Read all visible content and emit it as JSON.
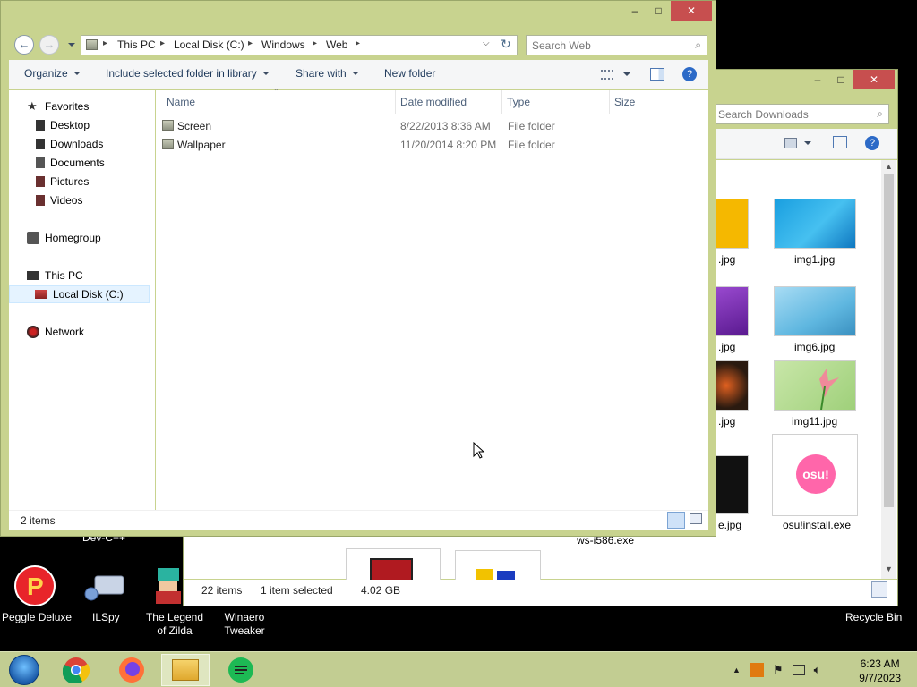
{
  "desktop": {
    "icons": [
      {
        "label": "Peggle Deluxe",
        "icon": "peggle-icon"
      },
      {
        "label": "ILSpy",
        "icon": "ilspy-icon"
      },
      {
        "label": "The Legend of Zilda",
        "icon": "zilda-icon"
      },
      {
        "label": "Winaero Tweaker",
        "icon": "winaero-icon"
      },
      {
        "label": "Recycle Bin",
        "icon": "recycle-bin-icon"
      }
    ],
    "partial_labels": {
      "devcpp": "Dev-C++",
      "behind_exe": "ws-i586.exe"
    }
  },
  "back_window": {
    "search_placeholder": "Search Downloads",
    "files": [
      {
        "name": ".jpg",
        "color": "#f5b800"
      },
      {
        "name": "img1.jpg",
        "color": "#1a9fe0"
      },
      {
        "name": ".jpg",
        "color": "#7a2fb5"
      },
      {
        "name": "img6.jpg",
        "color": "#5fb7e0"
      },
      {
        "name": ".jpg",
        "color": "#c4401a"
      },
      {
        "name": "img11.jpg",
        "color": "#9fd07a"
      },
      {
        "name": "e.jpg",
        "color": "#111111"
      },
      {
        "name": "osu!install.exe",
        "color": "#ff66aa"
      }
    ],
    "osu_logo_text": "osu!",
    "status": {
      "count": "22 items",
      "selected": "1 item selected",
      "size": "4.02 GB"
    }
  },
  "front_window": {
    "breadcrumb": [
      "This PC",
      "Local Disk (C:)",
      "Windows",
      "Web"
    ],
    "search_placeholder": "Search Web",
    "toolbar": {
      "organize": "Organize",
      "include": "Include selected folder in library",
      "share": "Share with",
      "new_folder": "New folder"
    },
    "nav": {
      "favorites": "Favorites",
      "desktop": "Desktop",
      "downloads": "Downloads",
      "documents": "Documents",
      "pictures": "Pictures",
      "videos": "Videos",
      "homegroup": "Homegroup",
      "this_pc": "This PC",
      "local_disk": "Local Disk (C:)",
      "network": "Network"
    },
    "columns": {
      "name": "Name",
      "date": "Date modified",
      "type": "Type",
      "size": "Size"
    },
    "rows": [
      {
        "name": "Screen",
        "date": "8/22/2013 8:36 AM",
        "type": "File folder"
      },
      {
        "name": "Wallpaper",
        "date": "11/20/2014 8:20 PM",
        "type": "File folder"
      }
    ],
    "status": "2 items"
  },
  "taskbar": {
    "clock_time": "6:23 AM",
    "clock_date": "9/7/2023",
    "pinned": [
      "start-orb-icon",
      "chrome-icon",
      "firefox-icon",
      "file-explorer-icon",
      "spotify-like-icon"
    ]
  }
}
